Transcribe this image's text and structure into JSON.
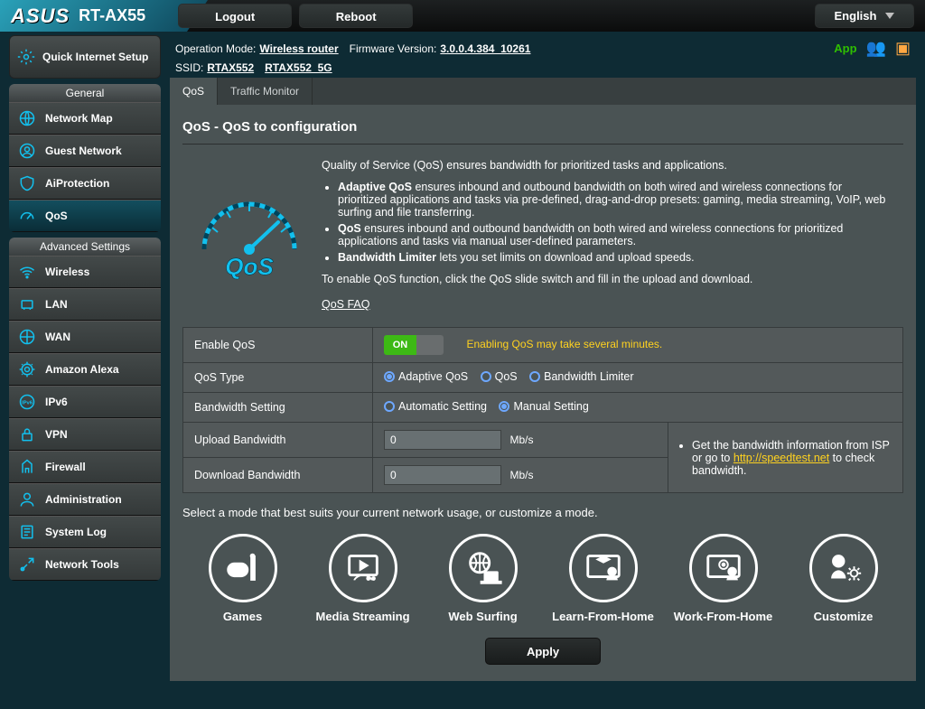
{
  "header": {
    "brand": "ASUS",
    "model": "RT-AX55",
    "logout": "Logout",
    "reboot": "Reboot",
    "language": "English"
  },
  "info": {
    "op_mode_label": "Operation Mode:",
    "op_mode": "Wireless router",
    "fw_label": "Firmware Version:",
    "fw": "3.0.0.4.384_10261",
    "ssid_label": "SSID:",
    "ssid1": "RTAX552",
    "ssid2": "RTAX552_5G",
    "app": "App"
  },
  "qis": "Quick Internet Setup",
  "general_header": "General",
  "general": [
    {
      "label": "Network Map"
    },
    {
      "label": "Guest Network"
    },
    {
      "label": "AiProtection"
    },
    {
      "label": "QoS"
    }
  ],
  "adv_header": "Advanced Settings",
  "adv": [
    {
      "label": "Wireless"
    },
    {
      "label": "LAN"
    },
    {
      "label": "WAN"
    },
    {
      "label": "Amazon Alexa"
    },
    {
      "label": "IPv6"
    },
    {
      "label": "VPN"
    },
    {
      "label": "Firewall"
    },
    {
      "label": "Administration"
    },
    {
      "label": "System Log"
    },
    {
      "label": "Network Tools"
    }
  ],
  "tabs": {
    "qos": "QoS",
    "tm": "Traffic Monitor"
  },
  "page": {
    "title": "QoS - QoS to configuration",
    "intro": "Quality of Service (QoS) ensures bandwidth for prioritized tasks and applications.",
    "b1_head": "Adaptive QoS",
    "b1": " ensures inbound and outbound bandwidth on both wired and wireless connections for prioritized applications and tasks via pre-defined, drag-and-drop presets: gaming, media streaming, VoIP, web surfing and file transferring.",
    "b2_head": "QoS",
    "b2": " ensures inbound and outbound bandwidth on both wired and wireless connections for prioritized applications and tasks via manual user-defined parameters.",
    "b3_head": "Bandwidth Limiter",
    "b3": " lets you set limits on download and upload speeds.",
    "enable": "To enable QoS function, click the QoS slide switch and fill in the upload and download.",
    "faq": "QoS FAQ",
    "form": {
      "enable": "Enable QoS",
      "on": "ON",
      "warn": "Enabling QoS may take several minutes.",
      "type": "QoS Type",
      "r1": "Adaptive QoS",
      "r2": "QoS",
      "r3": "Bandwidth Limiter",
      "bw": "Bandwidth Setting",
      "r4": "Automatic Setting",
      "r5": "Manual Setting",
      "up": "Upload Bandwidth",
      "down": "Download Bandwidth",
      "unit": "Mb/s",
      "upval": "0",
      "downval": "0",
      "tip_pre": "Get the bandwidth information from ISP or go to ",
      "tip_link": "http://speedtest.net",
      "tip_post": " to check bandwidth."
    },
    "modetxt": "Select a mode that best suits your current network usage, or customize a mode.",
    "modes": [
      "Games",
      "Media Streaming",
      "Web Surfing",
      "Learn-From-Home",
      "Work-From-Home",
      "Customize"
    ],
    "apply": "Apply"
  }
}
